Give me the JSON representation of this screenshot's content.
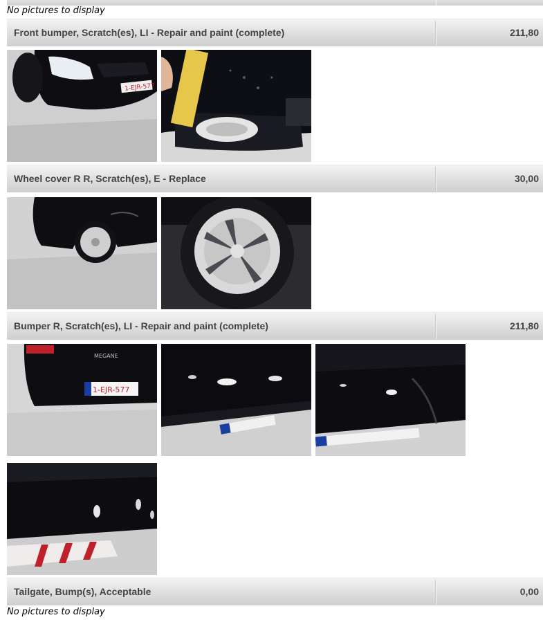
{
  "no_pictures_text": "No pictures to display",
  "damages": [
    {
      "description": "Front bumper, Scratch(es), LI - Repair and paint (complete)",
      "amount": "211,80"
    },
    {
      "description": "Wheel cover R R, Scratch(es), E - Replace",
      "amount": "30,00"
    },
    {
      "description": "Bumper R, Scratch(es), LI - Repair and paint (complete)",
      "amount": "211,80"
    },
    {
      "description": "Tailgate, Bump(s), Acceptable",
      "amount": "0,00"
    }
  ],
  "photos": {
    "license_plate_text": "1-EJR-577",
    "rear_badge_text": "MEGANE"
  },
  "colors": {
    "car_body": "#0d0d12",
    "floor": "#c9c9c9",
    "header_bar": "#dcdcdc",
    "plate_blue": "#1a3fa0",
    "plate_red": "#c0202a"
  }
}
